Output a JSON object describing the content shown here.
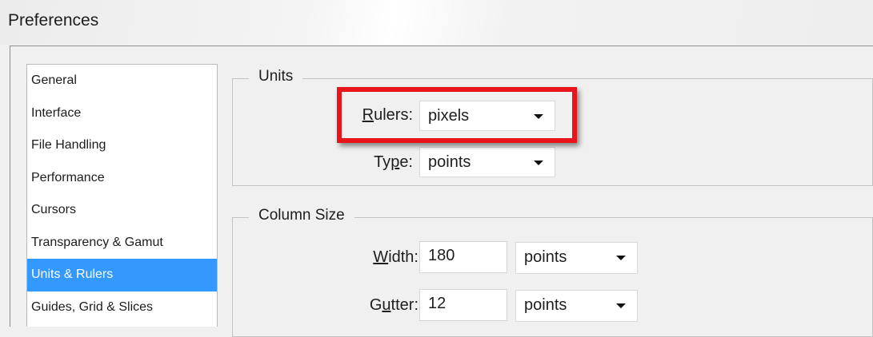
{
  "window": {
    "title": "Preferences"
  },
  "nav": {
    "items": [
      {
        "label": "General",
        "selected": false
      },
      {
        "label": "Interface",
        "selected": false
      },
      {
        "label": "File Handling",
        "selected": false
      },
      {
        "label": "Performance",
        "selected": false
      },
      {
        "label": "Cursors",
        "selected": false
      },
      {
        "label": "Transparency & Gamut",
        "selected": false
      },
      {
        "label": "Units & Rulers",
        "selected": true
      },
      {
        "label": "Guides, Grid & Slices",
        "selected": false
      }
    ],
    "selected_color": "#3399ff"
  },
  "units": {
    "title": "Units",
    "rulers": {
      "label_mnemonic": "R",
      "label_rest": "ulers:",
      "value": "pixels"
    },
    "type": {
      "label_pre": "Ty",
      "label_mnemonic": "p",
      "label_rest": "e:",
      "value": "points"
    }
  },
  "column_size": {
    "title": "Column Size",
    "width": {
      "label_mnemonic": "W",
      "label_rest": "idth:",
      "value": "180",
      "unit": "points"
    },
    "gutter": {
      "label_pre": "G",
      "label_mnemonic": "u",
      "label_rest": "tter:",
      "value": "12",
      "unit": "points"
    }
  },
  "annotation": {
    "highlight_color": "#e8141c",
    "target": "rulers"
  }
}
